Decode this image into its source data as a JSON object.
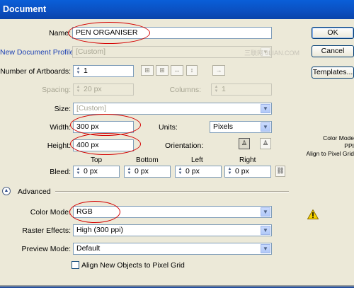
{
  "window": {
    "title": "Document"
  },
  "name": {
    "label": "Name:",
    "value": "PEN ORGANISER"
  },
  "profile": {
    "label": "New Document Profile:",
    "value": "[Custom]"
  },
  "artboards": {
    "label": "Number of Artboards:",
    "value": "1"
  },
  "spacing": {
    "label": "Spacing:",
    "value": "20 px"
  },
  "columns": {
    "label": "Columns:",
    "value": "1"
  },
  "size": {
    "label": "Size:",
    "value": "[Custom]"
  },
  "width": {
    "label": "Width:",
    "value": "300 px"
  },
  "units": {
    "label": "Units:",
    "value": "Pixels"
  },
  "height": {
    "label": "Height:",
    "value": "400 px"
  },
  "orientation": {
    "label": "Orientation:"
  },
  "bleed": {
    "label": "Bleed:",
    "top": {
      "label": "Top",
      "value": "0 px"
    },
    "bottom": {
      "label": "Bottom",
      "value": "0 px"
    },
    "left": {
      "label": "Left",
      "value": "0 px"
    },
    "right": {
      "label": "Right",
      "value": "0 px"
    }
  },
  "advanced": {
    "label": "Advanced",
    "color_mode": {
      "label": "Color Mode:",
      "value": "RGB"
    },
    "raster_effects": {
      "label": "Raster Effects:",
      "value": "High (300 ppi)"
    },
    "preview_mode": {
      "label": "Preview Mode:",
      "value": "Default"
    },
    "align_pixel_grid": {
      "label": "Align New Objects to Pixel Grid",
      "checked": false
    }
  },
  "buttons": {
    "ok": "OK",
    "cancel": "Cancel",
    "templates": "Templates..."
  },
  "side_info": {
    "line1": "Color Mode",
    "line2": "PPI",
    "line3": "Align to Pixel Grid"
  },
  "watermark": "三联网 3LIAN.COM"
}
